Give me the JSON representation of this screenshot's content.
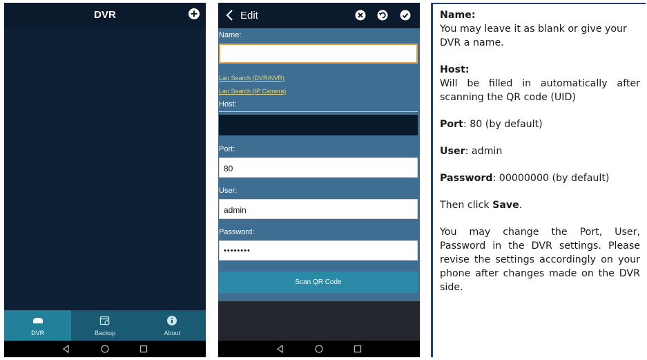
{
  "phone_list": {
    "title": "DVR",
    "tabs": [
      {
        "label": "DVR",
        "icon": "dvr-icon"
      },
      {
        "label": "Backup",
        "icon": "backup-icon"
      },
      {
        "label": "About",
        "icon": "info-icon"
      }
    ]
  },
  "phone_edit": {
    "title": "Edit",
    "name_label": "Name:",
    "name_value": "",
    "lan_search_dvr": "Lan Search (DVR/NVR)",
    "lan_search_cam": "Lan Search (IP Camera)",
    "host_label": "Host:",
    "host_value": "",
    "port_label": "Port:",
    "port_value": "80",
    "user_label": "User:",
    "user_value": "admin",
    "password_label": "Password:",
    "password_value": "••••••••",
    "scan_button": "Scan QR Code"
  },
  "info": {
    "name_heading": "Name:",
    "name_text": "You may leave it as blank or give your DVR a name.",
    "host_heading": "Host:",
    "host_text": "Will be filled in automatically after scanning the QR code (UID)",
    "port_bold": "Port",
    "port_text": ": 80 (by default)",
    "user_bold": "User",
    "user_text": ": admin",
    "password_bold": "Password",
    "password_text": ": 00000000 (by default)",
    "then_text": "Then click ",
    "save_bold": "Save",
    "save_dot": ".",
    "change_text": "You may change the Port, User, Password in the DVR settings. Please revise the settings accordingly on your phone after changes made on the DVR side."
  },
  "colors": {
    "header": "#0b1a2d",
    "form_bg": "#3e6f93",
    "accent_orange": "#f29a3a",
    "tab_active": "#22809a",
    "panel_border": "#1d3f73"
  }
}
